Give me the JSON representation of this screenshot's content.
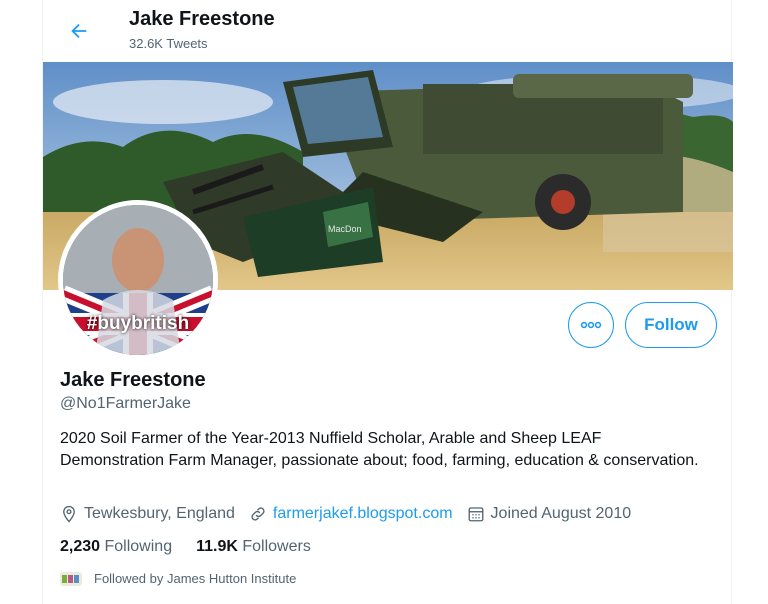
{
  "header": {
    "title": "Jake Freestone",
    "tweet_count": "32.6K Tweets"
  },
  "banner": {
    "image_label": "Combine harvester in a wheat field",
    "harvester_brand_text": "MacDon"
  },
  "avatar": {
    "image_label": "Profile photo with Union Jack overlay",
    "overlay_text": "#buybritish"
  },
  "actions": {
    "more_icon": "more-dots-icon",
    "follow_label": "Follow"
  },
  "profile": {
    "name": "Jake Freestone",
    "handle": "@No1FarmerJake",
    "bio": "2020 Soil Farmer of the Year-2013 Nuffield Scholar, Arable and Sheep LEAF Demonstration Farm Manager, passionate about; food, farming, education & conservation.",
    "location": "Tewkesbury, England",
    "website": "farmerjakef.blogspot.com",
    "joined": "Joined August 2010"
  },
  "stats": {
    "following_count": "2,230",
    "following_label": "Following",
    "followers_count": "11.9K",
    "followers_label": "Followers"
  },
  "followed_by": {
    "text": "Followed by James Hutton Institute"
  },
  "colors": {
    "accent": "#1d9bf0",
    "text_primary": "#0f1419",
    "text_secondary": "#536471"
  }
}
